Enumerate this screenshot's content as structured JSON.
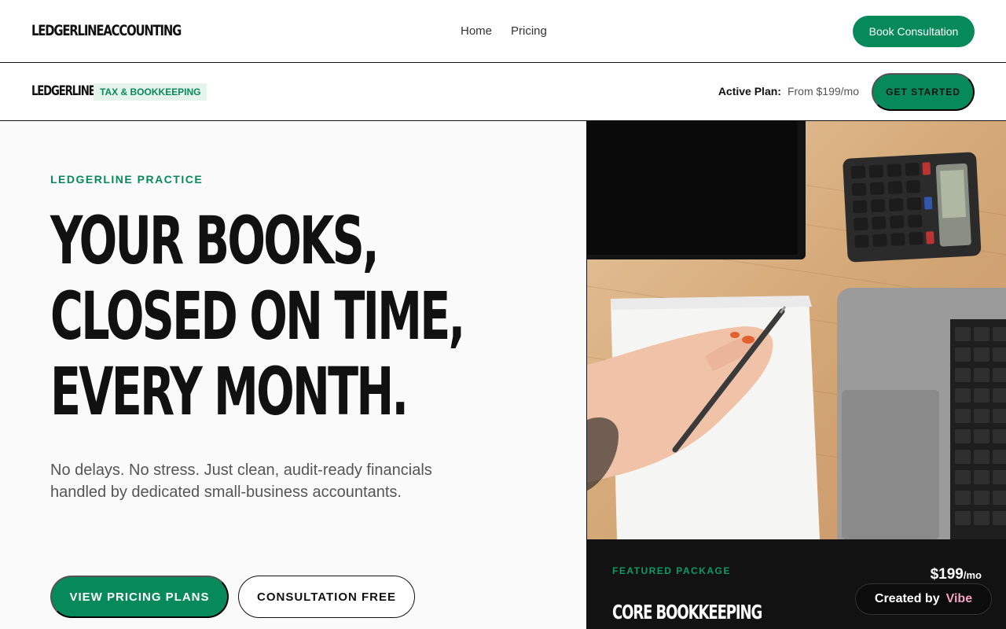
{
  "header": {
    "logo": "LEDGERLINEACCOUNTING",
    "nav": [
      "Home",
      "Pricing"
    ],
    "cta": "Book Consultation"
  },
  "subheader": {
    "logo": "LEDGERLINE",
    "tag": "TAX & BOOKKEEPING",
    "plan_label": "Active Plan:",
    "plan_value": "From $199/mo",
    "cta": "GET STARTED"
  },
  "hero": {
    "eyebrow": "LEDGERLINE PRACTICE",
    "headline": [
      "YOUR BOOKS,",
      "CLOSED ON TIME,",
      "EVERY MONTH."
    ],
    "subtext": "No delays. No stress. Just clean, audit-ready financials handled by dedicated small-business accountants.",
    "primary_button": "VIEW PRICING PLANS",
    "secondary_button": "CONSULTATION FREE"
  },
  "featured": {
    "eyebrow": "FEATURED PACKAGE",
    "price": "$199",
    "price_unit": "/mo",
    "title": "CORE BOOKKEEPING"
  },
  "badge": {
    "prefix": "Created by",
    "brand": "Vibe"
  },
  "colors": {
    "accent": "#078a5b",
    "dark": "#121212"
  }
}
